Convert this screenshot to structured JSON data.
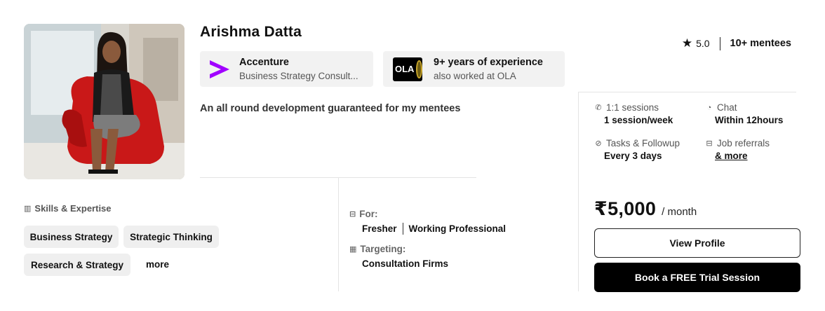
{
  "mentor": {
    "name": "Arishma Datta",
    "tagline": "An all round development guaranteed for my mentees"
  },
  "company": {
    "name": "Accenture",
    "role": "Business Strategy Consult..."
  },
  "experience": {
    "years": "9+ years of experience",
    "also": "also worked at OLA",
    "logo_text": "OLA"
  },
  "rating": {
    "score": "5.0",
    "mentees": "10+ mentees"
  },
  "features": {
    "sessions_label": "1:1 sessions",
    "sessions_value": "1 session/week",
    "chat_label": "Chat",
    "chat_value": "Within 12hours",
    "tasks_label": "Tasks & Followup",
    "tasks_value": "Every 3 days",
    "referrals_label": "Job referrals",
    "referrals_value": "& more"
  },
  "skills": {
    "title": "Skills & Expertise",
    "items": [
      "Business Strategy",
      "Strategic Thinking",
      "Research & Strategy"
    ],
    "more": "more"
  },
  "audience": {
    "for_title": "For:",
    "for_items": [
      "Fresher",
      "Working Professional"
    ],
    "targeting_title": "Targeting:",
    "targeting_value": "Consultation Firms"
  },
  "pricing": {
    "amount": "₹5,000",
    "period": "/ month"
  },
  "actions": {
    "view_profile": "View Profile",
    "book_trial": "Book a FREE Trial Session"
  },
  "colors": {
    "accent_purple": "#a100ff",
    "button_dark": "#000000",
    "chip_bg": "#efefef"
  }
}
